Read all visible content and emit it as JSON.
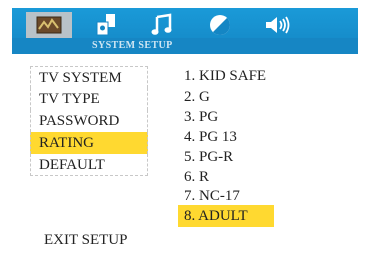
{
  "header": {
    "title": "SYSTEM SETUP",
    "tabs": [
      {
        "icon": "system-setup-icon",
        "selected": true
      },
      {
        "icon": "speaker-setup-icon",
        "selected": false
      },
      {
        "icon": "audio-note-icon",
        "selected": false
      },
      {
        "icon": "video-setup-icon",
        "selected": false
      },
      {
        "icon": "volume-icon",
        "selected": false
      }
    ]
  },
  "menu": {
    "items": [
      {
        "label": "TV SYSTEM"
      },
      {
        "label": "TV TYPE"
      },
      {
        "label": "PASSWORD"
      },
      {
        "label": "RATING",
        "selected": true
      },
      {
        "label": "DEFAULT"
      }
    ]
  },
  "rating": {
    "options": [
      "1. KID SAFE",
      "2. G",
      "3. PG",
      "4. PG 13",
      "5. PG-R",
      "6. R",
      "7. NC-17",
      "8. ADULT"
    ],
    "selected_index": 7
  },
  "footer": {
    "exit_label": "EXIT SETUP"
  },
  "colors": {
    "header_blue": "#1a9ad8",
    "highlight": "#ffd930"
  }
}
